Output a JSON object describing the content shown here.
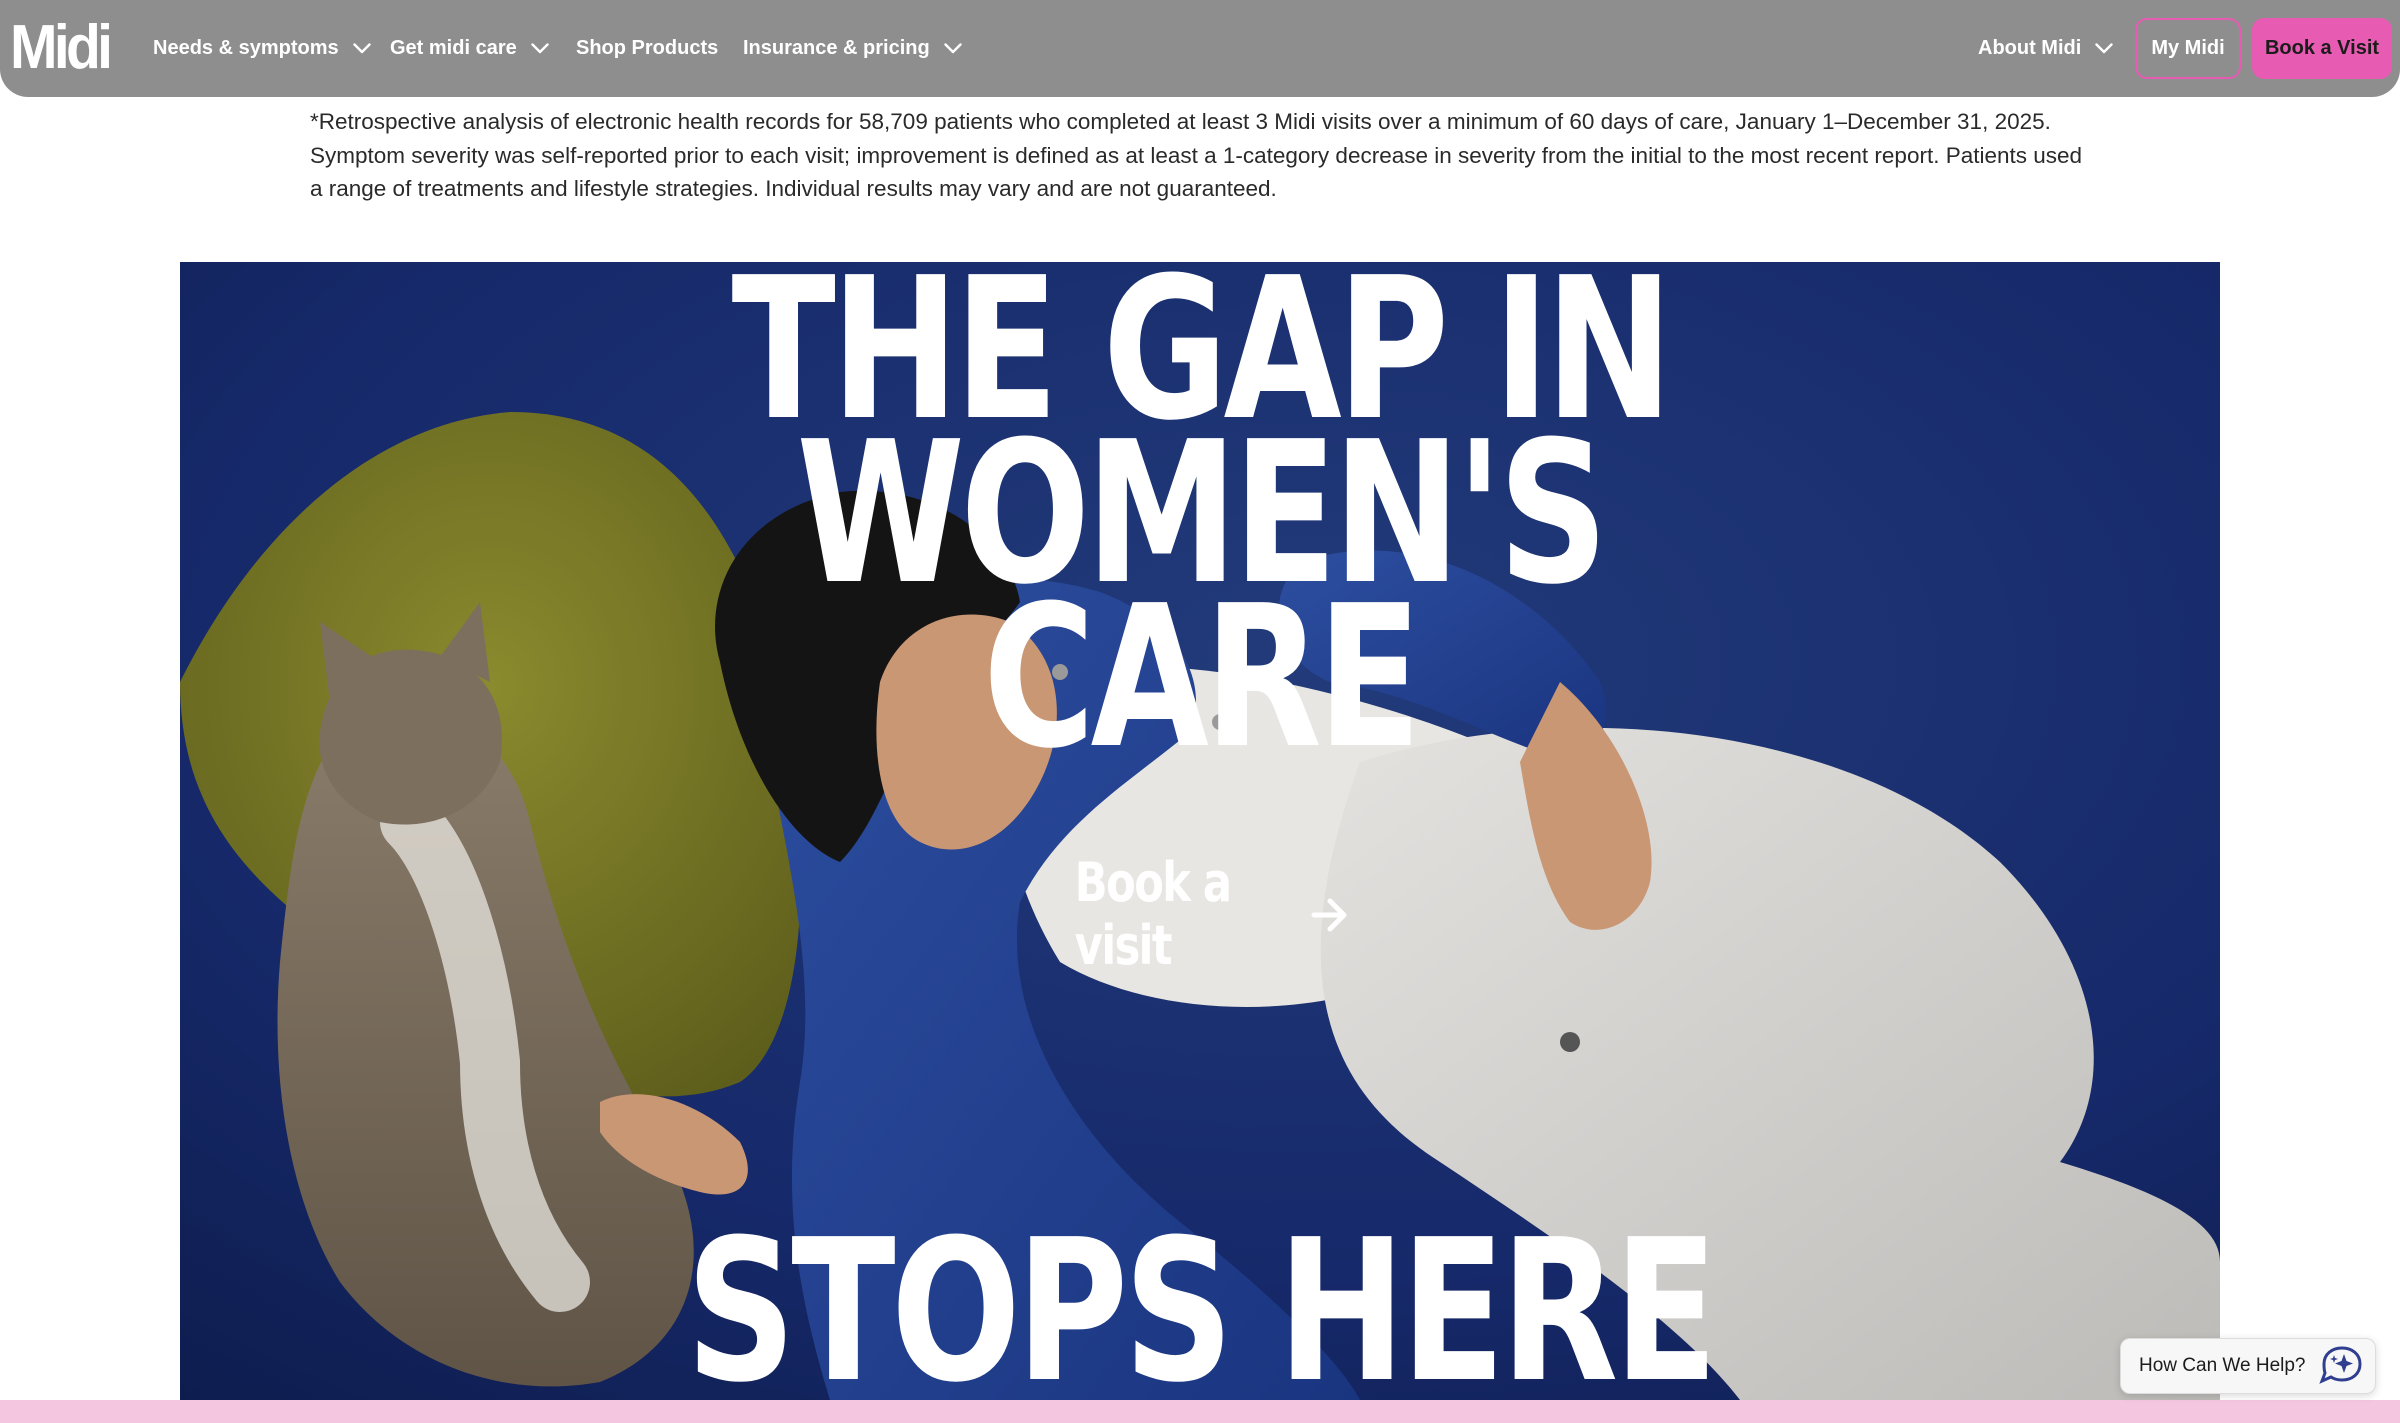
{
  "brand": {
    "logo_text": "Midi",
    "accent_color": "#e85bb2",
    "nav_bg_color": "#8e8e8e"
  },
  "nav": {
    "items": [
      {
        "label": "Needs & symptoms",
        "has_dropdown": true
      },
      {
        "label": "Get midi care",
        "has_dropdown": true
      },
      {
        "label": "Shop Products",
        "has_dropdown": false
      },
      {
        "label": "Insurance & pricing",
        "has_dropdown": true
      }
    ],
    "about_label": "About Midi",
    "my_midi_label": "My Midi",
    "book_label": "Book a Visit"
  },
  "disclaimer": {
    "text": "*Retrospective analysis of electronic health records for 58,709 patients who completed at least 3 Midi visits over a minimum of 60 days of care, January 1–December 31, 2025. Symptom severity was self-reported prior to each visit; improvement is defined as at least a 1-category decrease in severity from the initial to the most recent report. Patients used a range of treatments and lifestyle strategies. Individual results may vary and are not guaranteed."
  },
  "hero": {
    "headline_line1": "THE GAP IN WOMEN'S",
    "headline_line2": "CARE",
    "headline_bottom": "STOPS HERE",
    "cta_label": "Book a visit",
    "cta_icon": "arrow-right-icon"
  },
  "help_widget": {
    "label": "How Can We Help?",
    "icon": "chat-sparkle-icon"
  }
}
